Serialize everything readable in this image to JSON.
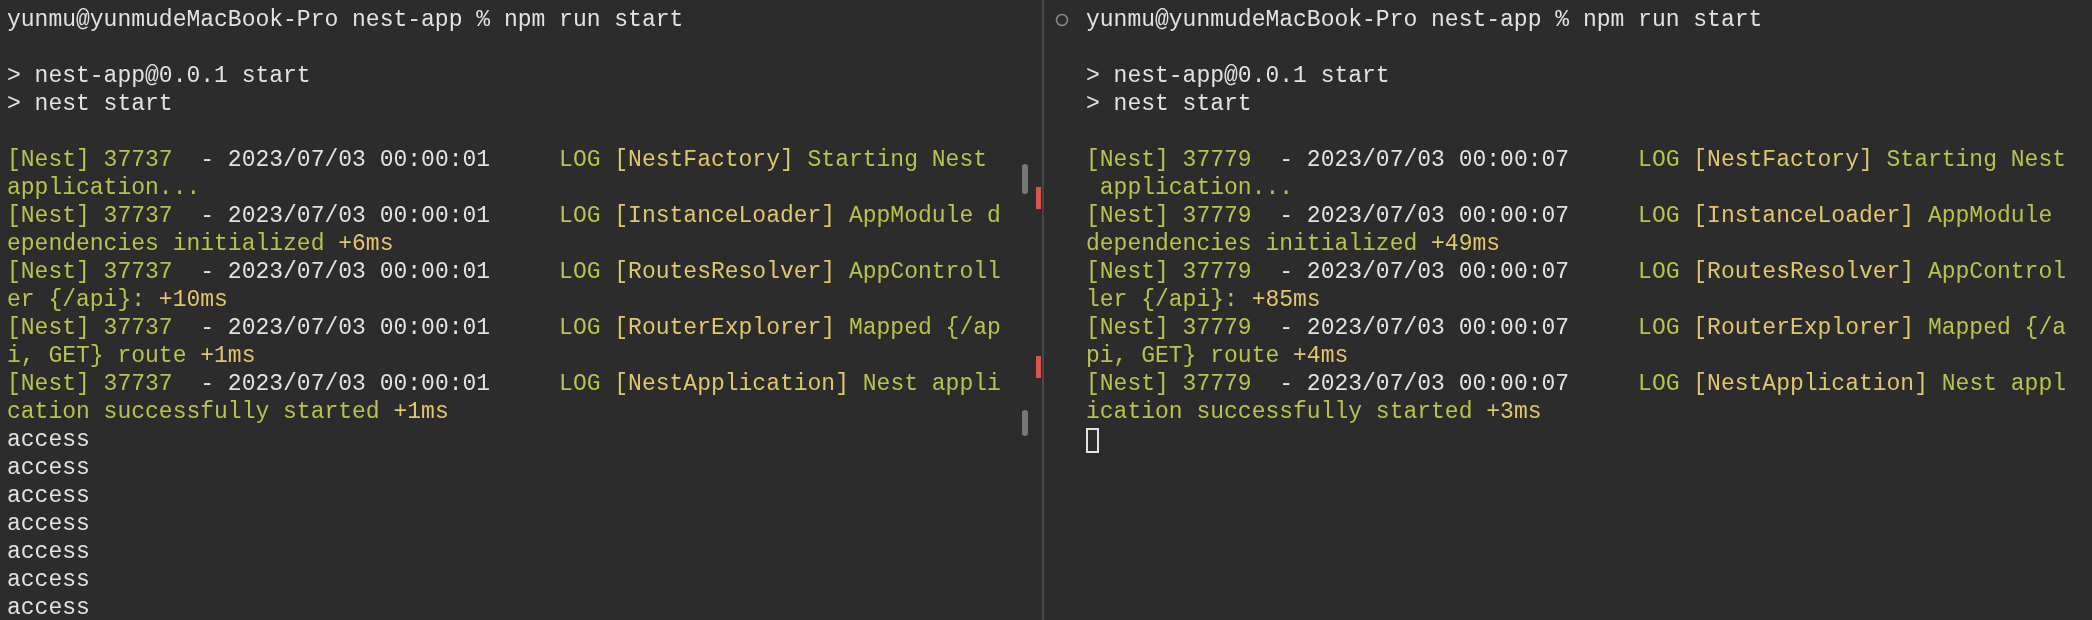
{
  "panes": [
    {
      "prompt_mark": false,
      "cursor": false,
      "lines": [
        {
          "kind": "text",
          "segments": [
            {
              "text": "yunmu@yunmudeMacBook-Pro nest-app % npm run start",
              "color": "#e2e2e2"
            }
          ]
        },
        {
          "kind": "blank"
        },
        {
          "kind": "text",
          "segments": [
            {
              "text": "> nest-app@0.0.1 start",
              "color": "#e2e2e2"
            }
          ]
        },
        {
          "kind": "text",
          "segments": [
            {
              "text": "> nest start",
              "color": "#e2e2e2"
            }
          ]
        },
        {
          "kind": "blank"
        },
        {
          "kind": "text",
          "segments": [
            {
              "text": "[Nest] 37737",
              "color": "#b9c24f"
            },
            {
              "text": "  - 2023/07/03 00:00:01",
              "color": "#e2e2e2"
            },
            {
              "text": "     LOG",
              "color": "#b9c24f"
            },
            {
              "text": " [NestFactory]",
              "color": "#e0c66c"
            },
            {
              "text": " Starting Nest",
              "color": "#b9c24f"
            }
          ]
        },
        {
          "kind": "text",
          "segments": [
            {
              "text": "application...",
              "color": "#b9c24f"
            }
          ]
        },
        {
          "kind": "text",
          "segments": [
            {
              "text": "[Nest] 37737",
              "color": "#b9c24f"
            },
            {
              "text": "  - 2023/07/03 00:00:01",
              "color": "#e2e2e2"
            },
            {
              "text": "     LOG",
              "color": "#b9c24f"
            },
            {
              "text": " [InstanceLoader]",
              "color": "#e0c66c"
            },
            {
              "text": " AppModule d",
              "color": "#b9c24f"
            }
          ]
        },
        {
          "kind": "text",
          "segments": [
            {
              "text": "ependencies initialized",
              "color": "#b9c24f"
            },
            {
              "text": " +6ms",
              "color": "#e0c66c"
            }
          ]
        },
        {
          "kind": "text",
          "segments": [
            {
              "text": "[Nest] 37737",
              "color": "#b9c24f"
            },
            {
              "text": "  - 2023/07/03 00:00:01",
              "color": "#e2e2e2"
            },
            {
              "text": "     LOG",
              "color": "#b9c24f"
            },
            {
              "text": " [RoutesResolver]",
              "color": "#e0c66c"
            },
            {
              "text": " AppControll",
              "color": "#b9c24f"
            }
          ]
        },
        {
          "kind": "text",
          "segments": [
            {
              "text": "er {/api}:",
              "color": "#b9c24f"
            },
            {
              "text": " +10ms",
              "color": "#e0c66c"
            }
          ]
        },
        {
          "kind": "text",
          "segments": [
            {
              "text": "[Nest] 37737",
              "color": "#b9c24f"
            },
            {
              "text": "  - 2023/07/03 00:00:01",
              "color": "#e2e2e2"
            },
            {
              "text": "     LOG",
              "color": "#b9c24f"
            },
            {
              "text": " [RouterExplorer]",
              "color": "#e0c66c"
            },
            {
              "text": " Mapped {/ap",
              "color": "#b9c24f"
            }
          ]
        },
        {
          "kind": "text",
          "segments": [
            {
              "text": "i, GET} route",
              "color": "#b9c24f"
            },
            {
              "text": " +1ms",
              "color": "#e0c66c"
            }
          ]
        },
        {
          "kind": "text",
          "segments": [
            {
              "text": "[Nest] 37737",
              "color": "#b9c24f"
            },
            {
              "text": "  - 2023/07/03 00:00:01",
              "color": "#e2e2e2"
            },
            {
              "text": "     LOG",
              "color": "#b9c24f"
            },
            {
              "text": " [NestApplication]",
              "color": "#e0c66c"
            },
            {
              "text": " Nest appli",
              "color": "#b9c24f"
            }
          ]
        },
        {
          "kind": "text",
          "segments": [
            {
              "text": "cation successfully started",
              "color": "#b9c24f"
            },
            {
              "text": " +1ms",
              "color": "#e0c66c"
            }
          ]
        },
        {
          "kind": "text",
          "segments": [
            {
              "text": "access",
              "color": "#e2e2e2"
            }
          ]
        },
        {
          "kind": "text",
          "segments": [
            {
              "text": "access",
              "color": "#e2e2e2"
            }
          ]
        },
        {
          "kind": "text",
          "segments": [
            {
              "text": "access",
              "color": "#e2e2e2"
            }
          ]
        },
        {
          "kind": "text",
          "segments": [
            {
              "text": "access",
              "color": "#e2e2e2"
            }
          ]
        },
        {
          "kind": "text",
          "segments": [
            {
              "text": "access",
              "color": "#e2e2e2"
            }
          ]
        },
        {
          "kind": "text",
          "segments": [
            {
              "text": "access",
              "color": "#e2e2e2"
            }
          ]
        },
        {
          "kind": "text",
          "segments": [
            {
              "text": "access",
              "color": "#e2e2e2"
            }
          ]
        }
      ]
    },
    {
      "prompt_mark": true,
      "cursor": true,
      "lines": [
        {
          "kind": "text",
          "segments": [
            {
              "text": "yunmu@yunmudeMacBook-Pro nest-app % npm run start",
              "color": "#e2e2e2"
            }
          ]
        },
        {
          "kind": "blank"
        },
        {
          "kind": "text",
          "segments": [
            {
              "text": "> nest-app@0.0.1 start",
              "color": "#e2e2e2"
            }
          ]
        },
        {
          "kind": "text",
          "segments": [
            {
              "text": "> nest start",
              "color": "#e2e2e2"
            }
          ]
        },
        {
          "kind": "blank"
        },
        {
          "kind": "text",
          "segments": [
            {
              "text": "[Nest] 37779",
              "color": "#b9c24f"
            },
            {
              "text": "  - 2023/07/03 00:00:07",
              "color": "#e2e2e2"
            },
            {
              "text": "     LOG",
              "color": "#b9c24f"
            },
            {
              "text": " [NestFactory]",
              "color": "#e0c66c"
            },
            {
              "text": " Starting Nest",
              "color": "#b9c24f"
            }
          ]
        },
        {
          "kind": "text",
          "segments": [
            {
              "text": " application...",
              "color": "#b9c24f"
            }
          ]
        },
        {
          "kind": "text",
          "segments": [
            {
              "text": "[Nest] 37779",
              "color": "#b9c24f"
            },
            {
              "text": "  - 2023/07/03 00:00:07",
              "color": "#e2e2e2"
            },
            {
              "text": "     LOG",
              "color": "#b9c24f"
            },
            {
              "text": " [InstanceLoader]",
              "color": "#e0c66c"
            },
            {
              "text": " AppModule",
              "color": "#b9c24f"
            }
          ]
        },
        {
          "kind": "text",
          "segments": [
            {
              "text": "dependencies initialized",
              "color": "#b9c24f"
            },
            {
              "text": " +49ms",
              "color": "#e0c66c"
            }
          ]
        },
        {
          "kind": "text",
          "segments": [
            {
              "text": "[Nest] 37779",
              "color": "#b9c24f"
            },
            {
              "text": "  - 2023/07/03 00:00:07",
              "color": "#e2e2e2"
            },
            {
              "text": "     LOG",
              "color": "#b9c24f"
            },
            {
              "text": " [RoutesResolver]",
              "color": "#e0c66c"
            },
            {
              "text": " AppControl",
              "color": "#b9c24f"
            }
          ]
        },
        {
          "kind": "text",
          "segments": [
            {
              "text": "ler {/api}:",
              "color": "#b9c24f"
            },
            {
              "text": " +85ms",
              "color": "#e0c66c"
            }
          ]
        },
        {
          "kind": "text",
          "segments": [
            {
              "text": "[Nest] 37779",
              "color": "#b9c24f"
            },
            {
              "text": "  - 2023/07/03 00:00:07",
              "color": "#e2e2e2"
            },
            {
              "text": "     LOG",
              "color": "#b9c24f"
            },
            {
              "text": " [RouterExplorer]",
              "color": "#e0c66c"
            },
            {
              "text": " Mapped {/a",
              "color": "#b9c24f"
            }
          ]
        },
        {
          "kind": "text",
          "segments": [
            {
              "text": "pi, GET} route",
              "color": "#b9c24f"
            },
            {
              "text": " +4ms",
              "color": "#e0c66c"
            }
          ]
        },
        {
          "kind": "text",
          "segments": [
            {
              "text": "[Nest] 37779",
              "color": "#b9c24f"
            },
            {
              "text": "  - 2023/07/03 00:00:07",
              "color": "#e2e2e2"
            },
            {
              "text": "     LOG",
              "color": "#b9c24f"
            },
            {
              "text": " [NestApplication]",
              "color": "#e0c66c"
            },
            {
              "text": " Nest appl",
              "color": "#b9c24f"
            }
          ]
        },
        {
          "kind": "text",
          "segments": [
            {
              "text": "ication successfully started",
              "color": "#b9c24f"
            },
            {
              "text": " +3ms",
              "color": "#e0c66c"
            }
          ]
        }
      ]
    }
  ]
}
